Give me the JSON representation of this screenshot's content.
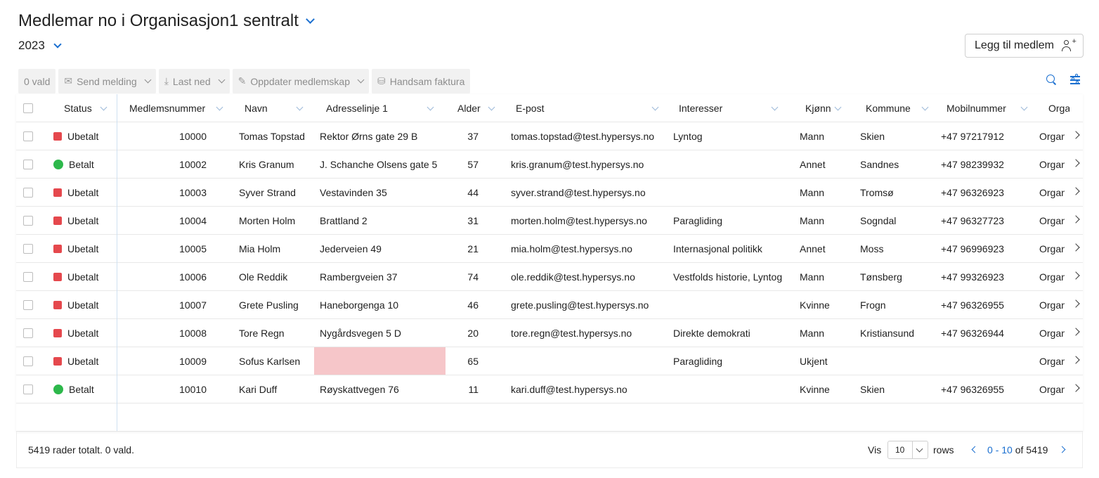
{
  "header": {
    "title": "Medlemar no i Organisasjon1 sentralt",
    "year": "2023",
    "add_member_label": "Legg til medlem"
  },
  "toolbar": {
    "selected_label": "0 vald",
    "send_message_label": "Send melding",
    "download_label": "Last ned",
    "update_membership_label": "Oppdater medlemskap",
    "invoice_label": "Handsam faktura"
  },
  "colors": {
    "accent": "#1a6fd0",
    "unpaid": "#e5484d",
    "paid": "#2db84b",
    "missing_address": "#f6c6c9"
  },
  "table": {
    "columns": [
      "Status",
      "Medlemsnummer",
      "Navn",
      "Adresselinje 1",
      "Alder",
      "E-post",
      "Interesser",
      "Kjønn",
      "Kommune",
      "Mobilnummer",
      "Orga"
    ],
    "rows": [
      {
        "status": "Ubetalt",
        "paid": false,
        "number": "10000",
        "name": "Tomas Topstad",
        "address": "Rektor Ørns gate 29 B",
        "age": "37",
        "email": "tomas.topstad@test.hypersys.no",
        "interests": "Lyntog",
        "gender": "Mann",
        "municipality": "Skien",
        "mobile": "+47 97217912",
        "org": "Organ"
      },
      {
        "status": "Betalt",
        "paid": true,
        "number": "10002",
        "name": "Kris Granum",
        "address": "J. Schanche Olsens gate 5",
        "age": "57",
        "email": "kris.granum@test.hypersys.no",
        "interests": "",
        "gender": "Annet",
        "municipality": "Sandnes",
        "mobile": "+47 98239932",
        "org": "Organ"
      },
      {
        "status": "Ubetalt",
        "paid": false,
        "number": "10003",
        "name": "Syver Strand",
        "address": "Vestavinden 35",
        "age": "44",
        "email": "syver.strand@test.hypersys.no",
        "interests": "",
        "gender": "Mann",
        "municipality": "Tromsø",
        "mobile": "+47 96326923",
        "org": "Organ"
      },
      {
        "status": "Ubetalt",
        "paid": false,
        "number": "10004",
        "name": "Morten Holm",
        "address": "Brattland 2",
        "age": "31",
        "email": "morten.holm@test.hypersys.no",
        "interests": "Paragliding",
        "gender": "Mann",
        "municipality": "Sogndal",
        "mobile": "+47 96327723",
        "org": "Organ"
      },
      {
        "status": "Ubetalt",
        "paid": false,
        "number": "10005",
        "name": "Mia Holm",
        "address": "Jederveien 49",
        "age": "21",
        "email": "mia.holm@test.hypersys.no",
        "interests": "Internasjonal politikk",
        "gender": "Annet",
        "municipality": "Moss",
        "mobile": "+47 96996923",
        "org": "Organ"
      },
      {
        "status": "Ubetalt",
        "paid": false,
        "number": "10006",
        "name": "Ole Reddik",
        "address": "Rambergveien 37",
        "age": "74",
        "email": "ole.reddik@test.hypersys.no",
        "interests": "Vestfolds historie, Lyntog",
        "gender": "Mann",
        "municipality": "Tønsberg",
        "mobile": "+47 99326923",
        "org": "Organ"
      },
      {
        "status": "Ubetalt",
        "paid": false,
        "number": "10007",
        "name": "Grete Pusling",
        "address": "Haneborgenga 10",
        "age": "46",
        "email": "grete.pusling@test.hypersys.no",
        "interests": "",
        "gender": "Kvinne",
        "municipality": "Frogn",
        "mobile": "+47 96326955",
        "org": "Organ"
      },
      {
        "status": "Ubetalt",
        "paid": false,
        "number": "10008",
        "name": "Tore Regn",
        "address": "Nygårdsvegen 5 D",
        "age": "20",
        "email": "tore.regn@test.hypersys.no",
        "interests": "Direkte demokrati",
        "gender": "Mann",
        "municipality": "Kristiansund",
        "mobile": "+47 96326944",
        "org": "Organ"
      },
      {
        "status": "Ubetalt",
        "paid": false,
        "number": "10009",
        "name": "Sofus Karlsen",
        "address": "",
        "age": "65",
        "email": "",
        "interests": "Paragliding",
        "gender": "Ukjent",
        "municipality": "",
        "mobile": "",
        "org": "Organ"
      },
      {
        "status": "Betalt",
        "paid": true,
        "number": "10010",
        "name": "Kari Duff",
        "address": "Røyskattvegen 76",
        "age": "11",
        "email": "kari.duff@test.hypersys.no",
        "interests": "",
        "gender": "Kvinne",
        "municipality": "Skien",
        "mobile": "+47 96326955",
        "org": "Organ"
      }
    ]
  },
  "footer": {
    "total_text": "5419 rader totalt. 0 vald.",
    "show_label": "Vis",
    "page_size": "10",
    "rows_label": "rows",
    "range_start": "0",
    "range_sep": "-",
    "range_end": "10",
    "of_label": "of 5419"
  }
}
